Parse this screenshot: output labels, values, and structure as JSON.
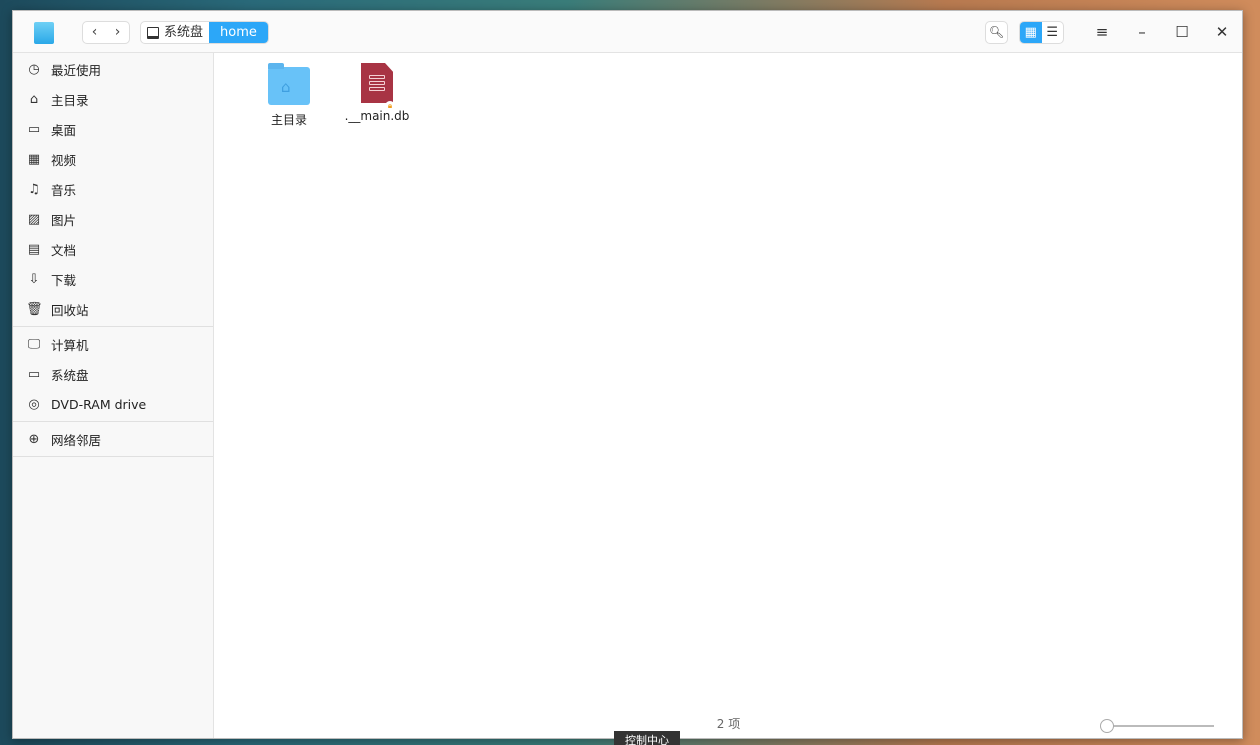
{
  "window": {
    "breadcrumb": [
      "系统盘",
      "home"
    ]
  },
  "toolbar": {
    "back": "‹",
    "forward": "›",
    "search_icon": "search-icon",
    "menu_icon": "menu-icon"
  },
  "sidebar": {
    "groups": [
      [
        "最近使用",
        "主目录",
        "桌面",
        "视频",
        "音乐",
        "图片",
        "文档",
        "下载",
        "回收站"
      ],
      [
        "计算机",
        "系统盘",
        "DVD-RAM drive"
      ],
      [
        "网络邻居"
      ]
    ]
  },
  "files": [
    {
      "name": "主目录",
      "type": "folder"
    },
    {
      "name": ".__main.db",
      "type": "database"
    }
  ],
  "status": {
    "count": "2 项",
    "zoom_level": 0
  },
  "taskbar": {
    "tooltip": "控制中心"
  },
  "colors": {
    "accent": "#2ca7f8",
    "db": "#a83444"
  }
}
